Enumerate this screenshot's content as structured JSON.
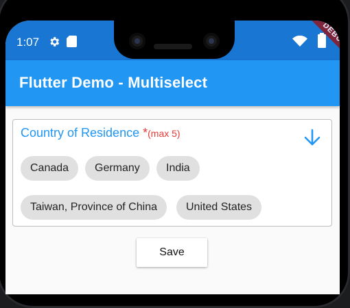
{
  "status_bar": {
    "time": "1:07",
    "icons": [
      "gear-icon",
      "sd-card-icon",
      "wifi-icon",
      "battery-icon"
    ],
    "debug_label": "DEBUG"
  },
  "app_bar": {
    "title": "Flutter Demo - Multiselect",
    "color": "#2196f3"
  },
  "multiselect": {
    "label": "Country of Residence",
    "required_mark": "*",
    "max_hint": "(max 5)",
    "label_color": "#2196f3",
    "hint_color": "#e53935",
    "dropdown_icon": "arrow-down-icon",
    "selected": [
      "Canada",
      "Germany",
      "India",
      "Taiwan, Province of China",
      "United States"
    ]
  },
  "actions": {
    "save_label": "Save"
  }
}
